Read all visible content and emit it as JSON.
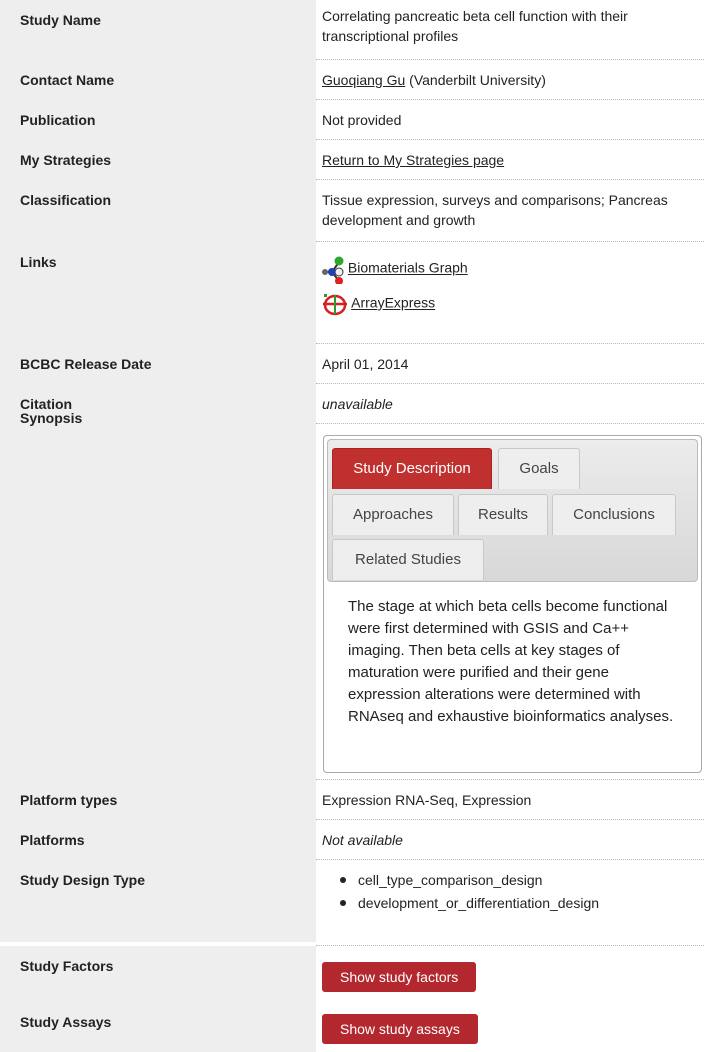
{
  "rows": {
    "study_name": {
      "label": "Study Name",
      "value": "Correlating pancreatic beta cell function with their transcriptional profiles"
    },
    "contact": {
      "label": "Contact Name",
      "link": "Guoqiang Gu",
      "rest": " (Vanderbilt University)"
    },
    "publication": {
      "label": "Publication",
      "value": "Not provided"
    },
    "strategies": {
      "label": "My Strategies",
      "link": "Return to My Strategies page"
    },
    "classification": {
      "label": "Classification",
      "value": "Tissue expression, surveys and comparisons; Pancreas development and growth"
    },
    "links": {
      "label": "Links",
      "items": [
        "Biomaterials Graph",
        "ArrayExpress"
      ],
      "icons": [
        "graph-icon",
        "arrayexpress-icon"
      ]
    },
    "release": {
      "label": "BCBC Release Date",
      "value": "April 01, 2014"
    },
    "citation": {
      "label": "Citation",
      "value": "unavailable"
    },
    "synopsis": {
      "label": "Synopsis",
      "tabs": [
        "Study Description",
        "Goals",
        "Approaches",
        "Results",
        "Conclusions",
        "Related Studies"
      ],
      "active_tab": "Study Description",
      "text": "The stage at which beta cells become functional were first determined with GSIS and Ca++ imaging. Then beta cells at key stages of maturation were purified and their gene expression alterations were determined with RNAseq and exhaustive bioinformatics analyses."
    },
    "platform_types": {
      "label": "Platform types",
      "value": "Expression RNA-Seq, Expression"
    },
    "platforms": {
      "label": "Platforms",
      "value": "Not available"
    },
    "design": {
      "label": "Study Design Type",
      "items": [
        "cell_type_comparison_design",
        "development_or_differentiation_design"
      ]
    },
    "factors": {
      "label": "Study Factors",
      "button": "Show study factors"
    },
    "assays": {
      "label": "Study Assays",
      "button": "Show study assays"
    }
  },
  "colors": {
    "accent": "#b3282e",
    "label_bg": "#eeeeee"
  }
}
